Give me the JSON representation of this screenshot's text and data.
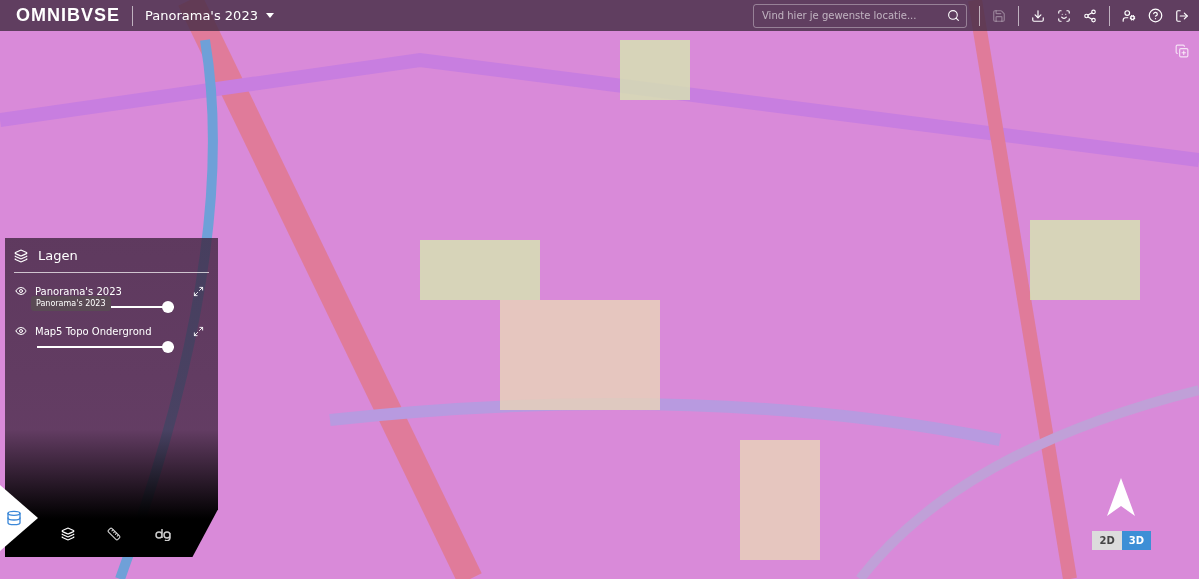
{
  "header": {
    "logo": "OMNIBVSE",
    "project": "Panorama's 2023",
    "search": {
      "placeholder": "Vind hier je gewenste locatie..."
    },
    "tools": [
      {
        "kind": "save",
        "disabled": true
      },
      {
        "kind": "download",
        "disabled": false
      },
      {
        "kind": "screenshot",
        "disabled": false
      },
      {
        "kind": "share",
        "disabled": false
      },
      {
        "kind": "user-settings",
        "disabled": false
      },
      {
        "kind": "help",
        "disabled": false
      },
      {
        "kind": "logout",
        "disabled": false
      }
    ]
  },
  "layers_panel": {
    "title": "Lagen",
    "layers": [
      {
        "name": "Panorama's 2023",
        "visible": true,
        "level": 1,
        "tooltip": "Panorama's 2023"
      },
      {
        "name": "Map5 Topo Ondergrond",
        "visible": true,
        "level": 1
      }
    ],
    "tabs": [
      {
        "kind": "layers",
        "selected": true
      },
      {
        "kind": "measure",
        "selected": false
      },
      {
        "kind": "logo",
        "selected": false
      }
    ]
  },
  "view_toggle": [
    {
      "label": "2D",
      "selected": false
    },
    {
      "label": "3D",
      "selected": true
    }
  ]
}
